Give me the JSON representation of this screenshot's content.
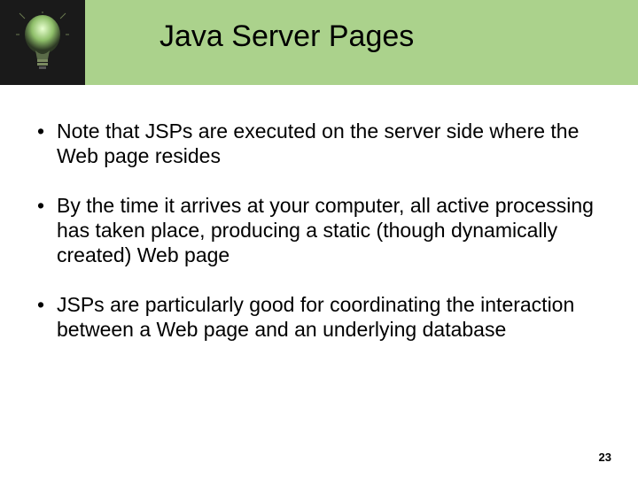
{
  "header": {
    "title": "Java Server Pages",
    "icon": "lightbulb-icon"
  },
  "bullets": [
    "Note that JSPs are executed on the server side where the Web page resides",
    "By the time it arrives at your computer, all active processing has taken place, producing a static (though dynamically created) Web page",
    "JSPs are particularly good for coordinating the interaction between a Web page and an underlying database"
  ],
  "page_number": "23"
}
